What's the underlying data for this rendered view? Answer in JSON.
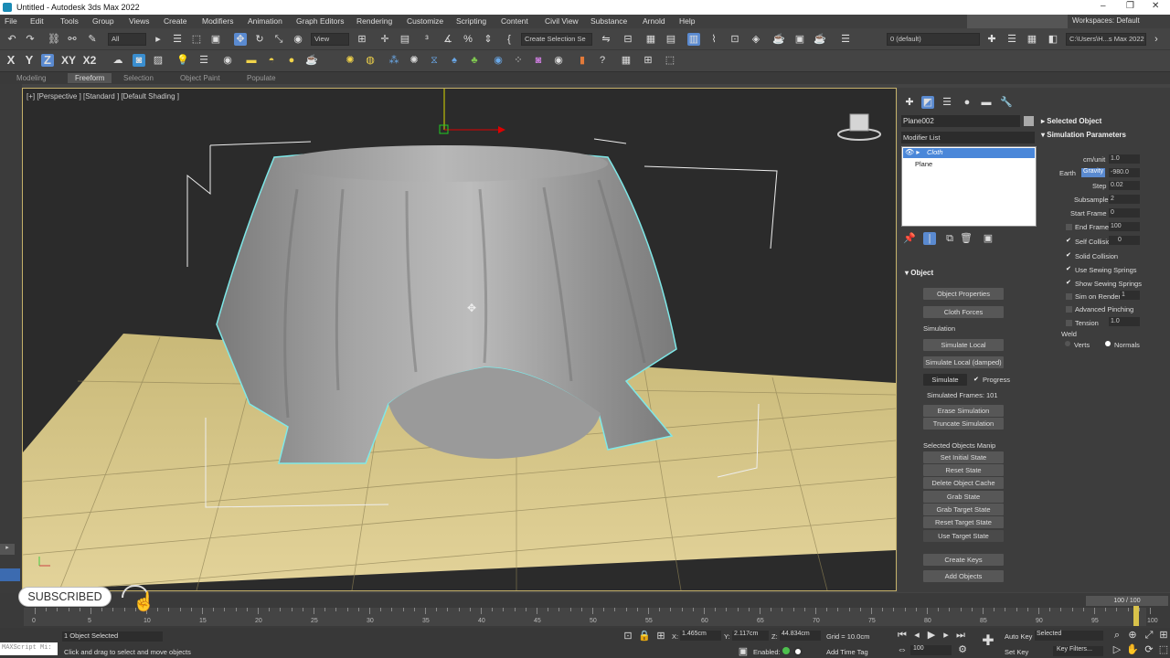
{
  "window": {
    "title": "Untitled - Autodesk 3ds Max 2022"
  },
  "menu": [
    "File",
    "Edit",
    "Tools",
    "Group",
    "Views",
    "Create",
    "Modifiers",
    "Animation",
    "Graph Editors",
    "Rendering",
    "Customize",
    "Scripting",
    "Content",
    "Civil View",
    "Substance",
    "Arnold",
    "Help"
  ],
  "workspace": {
    "label": "Workspaces: Default"
  },
  "toolbar": {
    "filter": "All",
    "view": "View",
    "selection_set": "Create Selection Se",
    "layer": "0 (default)",
    "path": "C:\\Users\\H...s Max 2022"
  },
  "axis": {
    "x": "X",
    "y": "Y",
    "z": "Z",
    "xy": "XY",
    "xz": "X2"
  },
  "ribbon": [
    "Modeling",
    "Freeform",
    "Selection",
    "Object Paint",
    "Populate"
  ],
  "viewport": {
    "label": "[+] [Perspective ] [Standard ] [Default Shading ]"
  },
  "cmd": {
    "object_name": "Plane002",
    "modifier_list": "Modifier List",
    "stack": [
      "Cloth",
      "Plane"
    ],
    "object_rollout": "Object",
    "object_properties": "Object Properties",
    "cloth_forces": "Cloth Forces",
    "simulation": "Simulation",
    "simulate_local": "Simulate Local",
    "simulate_local_damped": "Simulate Local (damped)",
    "simulate": "Simulate",
    "progress": "Progress",
    "simulated_frames": "Simulated Frames:",
    "frames_value": "101",
    "erase_simulation": "Erase Simulation",
    "truncate_simulation": "Truncate Simulation",
    "selected_objects_manip": "Selected Objects Manip",
    "set_initial_state": "Set Initial State",
    "reset_state": "Reset State",
    "delete_object_cache": "Delete Object Cache",
    "grab_state": "Grab State",
    "grab_target_state": "Grab Target State",
    "reset_target_state": "Reset Target State",
    "use_target_state": "Use Target State",
    "create_keys": "Create Keys",
    "add_objects": "Add Objects"
  },
  "params": {
    "selected_object": "Selected Object",
    "simulation_parameters": "Simulation Parameters",
    "cm_unit_label": "cm/unit",
    "cm_unit": "1.0",
    "earth": "Earth",
    "gravity": "Gravity",
    "gravity_value": "-980.0",
    "step_label": "Step",
    "step": "0.02",
    "subsample_label": "Subsample",
    "subsample": "2",
    "start_frame_label": "Start Frame",
    "start_frame": "0",
    "end_frame_label": "End Frame",
    "end_frame": "100",
    "self_collision": "Self Collision",
    "self_collision_value": "0",
    "solid_collision": "Solid Collision",
    "use_sewing_springs": "Use Sewing Springs",
    "show_sewing_springs": "Show Sewing Springs",
    "sim_on_render": "Sim on Render",
    "sim_on_render_value": "1",
    "advanced_pinching": "Advanced Pinching",
    "tension": "Tension",
    "tension_value": "1.0",
    "weld": "Weld",
    "verts": "Verts",
    "normals": "Normals"
  },
  "timeline": {
    "counter": "100 / 100",
    "ticks": [
      "0",
      "5",
      "10",
      "15",
      "20",
      "25",
      "30",
      "35",
      "40",
      "45",
      "50",
      "55",
      "60",
      "65",
      "70",
      "75",
      "80",
      "85",
      "90",
      "95",
      "100"
    ]
  },
  "status": {
    "selected": "1 Object Selected",
    "hint": "Click and drag to select and move objects",
    "maxscript": "MAXScript Mi:",
    "x": "1.465cm",
    "y": "2.117cm",
    "z": "44.834cm",
    "grid": "Grid = 10.0cm",
    "enabled": "Enabled:",
    "add_time_tag": "Add Time Tag",
    "frame": "100",
    "auto_key": "Auto Key",
    "selected_dd": "Selected",
    "set_key": "Set Key",
    "key_filters": "Key Filters..."
  },
  "overlay": {
    "subscribed": "SUBSCRIBED"
  }
}
